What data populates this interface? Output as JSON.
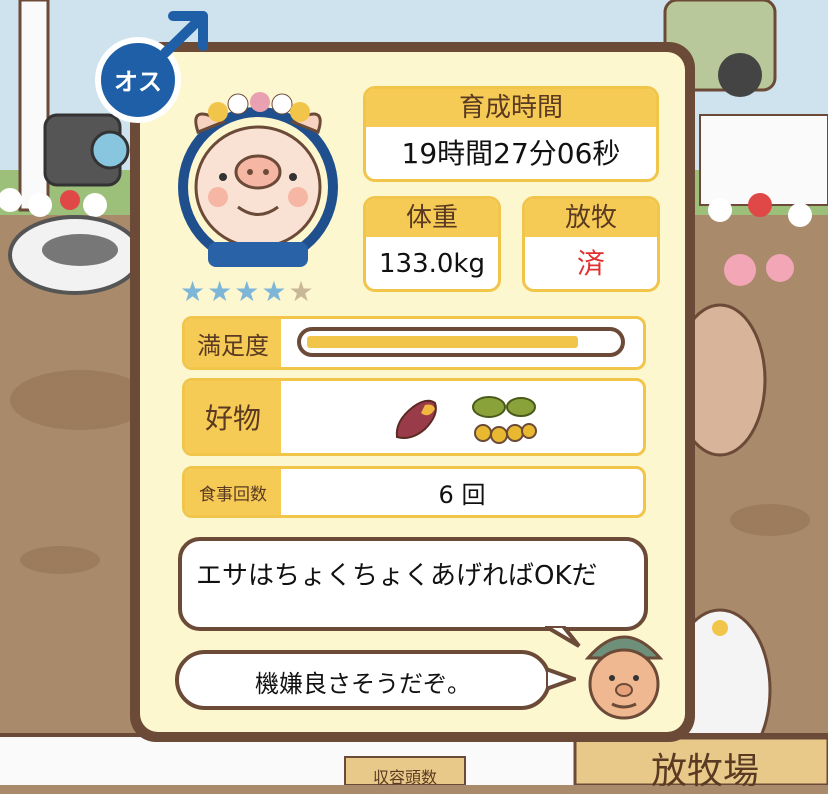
{
  "gender": {
    "label": "オス",
    "symbol": "♂"
  },
  "rating": {
    "stars_filled": 4,
    "stars_total": 5
  },
  "growth_time": {
    "label": "育成時間",
    "value": "19時間27分06秒"
  },
  "weight": {
    "label": "体重",
    "value": "133.0kg"
  },
  "grazing": {
    "label": "放牧",
    "value": "済",
    "value_color": "#e03030"
  },
  "satisfaction": {
    "label": "満足度",
    "level": 0.88
  },
  "favorite": {
    "label": "好物",
    "items": [
      "sweet-potato-icon",
      "acorn-branch-icon"
    ]
  },
  "meals": {
    "label": "食事回数",
    "value": "6 回"
  },
  "speech": {
    "advice": "エサはちょくちょくあげればOKだ",
    "mood": "機嫌良さそうだぞ。"
  },
  "background": {
    "sign_main": "放牧場",
    "sign_sub": "収容頭数"
  },
  "colors": {
    "frame": "#6b4a37",
    "panel": "#fdf7cf",
    "accent": "#f6cb55",
    "star_blue": "#7eb6d8"
  }
}
